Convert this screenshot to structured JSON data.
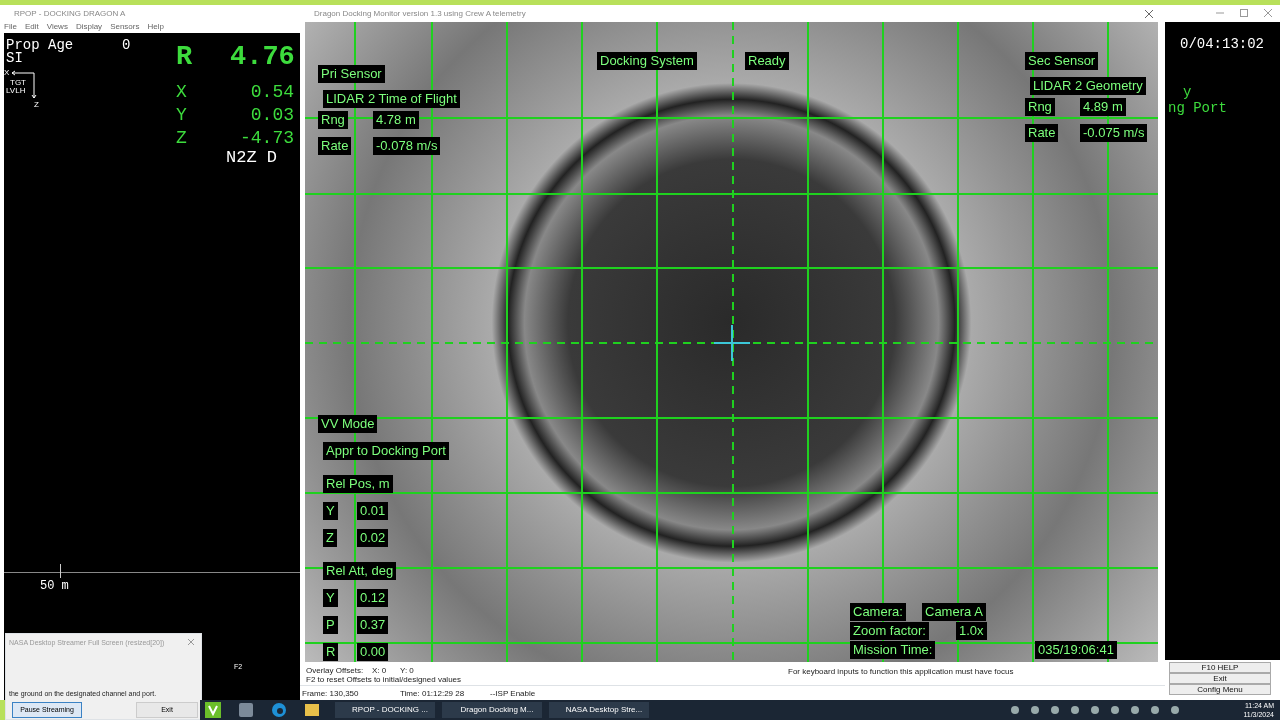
{
  "rpop_window": {
    "title": "RPOP - DOCKING DRAGON A",
    "menu": [
      "File",
      "Edit",
      "Views",
      "Display",
      "Sensors",
      "Help"
    ],
    "prop_age": {
      "label": "Prop Age",
      "value": "0"
    },
    "frame": "SI",
    "axes_diagram": {
      "x_label": "X",
      "tgt": "TGT",
      "lvlh": "LVLH",
      "z_label": "Z"
    },
    "range": {
      "label": "R",
      "value": "4.76"
    },
    "axes": [
      {
        "label": "X",
        "value": "0.54"
      },
      {
        "label": "Y",
        "value": "0.03"
      },
      {
        "label": "Z",
        "value": "-4.73"
      }
    ],
    "mode": "N2Z D",
    "scale": "50 m",
    "timer": "0/04:13:02",
    "right_lines": [
      "y",
      "ng Port"
    ],
    "f2_label": "F2",
    "buttons": [
      {
        "label": "F10 HELP"
      },
      {
        "label": "Exit"
      },
      {
        "label": "Config Menu"
      }
    ]
  },
  "docking_window": {
    "title": "Dragon Docking Monitor version 1.3 using Crew A telemetry",
    "pri_sensor": {
      "title": "Pri Sensor",
      "sensor": "LIDAR 2 Time of Flight",
      "rows": [
        {
          "label": "Rng",
          "value": "4.78 m"
        },
        {
          "label": "Rate",
          "value": "-0.078 m/s"
        }
      ]
    },
    "docking_system": {
      "label": "Docking System",
      "status": "Ready"
    },
    "sec_sensor": {
      "title": "Sec Sensor",
      "sensor": "LIDAR 2 Geometry",
      "rows": [
        {
          "label": "Rng",
          "value": "4.89 m"
        },
        {
          "label": "Rate",
          "value": "-0.075 m/s"
        }
      ]
    },
    "vv_mode": {
      "title": "VV Mode",
      "value": "Appr to Docking Port"
    },
    "rel_pos": {
      "title": "Rel Pos, m",
      "rows": [
        {
          "label": "Y",
          "value": "0.01"
        },
        {
          "label": "Z",
          "value": "0.02"
        }
      ]
    },
    "rel_att": {
      "title": "Rel Att, deg",
      "rows": [
        {
          "label": "Y",
          "value": "0.12"
        },
        {
          "label": "P",
          "value": "0.37"
        },
        {
          "label": "R",
          "value": "0.00"
        }
      ]
    },
    "camera_info": [
      {
        "label": "Camera:",
        "value": "Camera A"
      },
      {
        "label": "Zoom factor:",
        "value": "1.0x"
      },
      {
        "label": "Mission Time:",
        "value": "035/19:06:41"
      }
    ],
    "footer": {
      "offsets_label": "Overlay Offsets:",
      "offset_x": "X: 0",
      "offset_y": "Y: 0",
      "reset_hint": "F2 to reset Offsets to initial/designed values",
      "focus_hint": "For keyboard inputs to function this application must have focus"
    },
    "status_bar": [
      "Frame:  130,350",
      "Time: 01:12:29 28",
      "--ISP Enable"
    ]
  },
  "streamer_dialog": {
    "title": "NASA Desktop Streamer Full Screen (resized[20])",
    "message": "the ground on the designated channel and port.",
    "buttons": [
      "Pause Streaming",
      "Exit"
    ]
  },
  "taskbar": {
    "apps": [
      "RPOP - DOCKING ...",
      "Dragon Docking M...",
      "NASA Desktop Stre..."
    ],
    "time": "11:24 AM",
    "date": "11/3/2024"
  }
}
